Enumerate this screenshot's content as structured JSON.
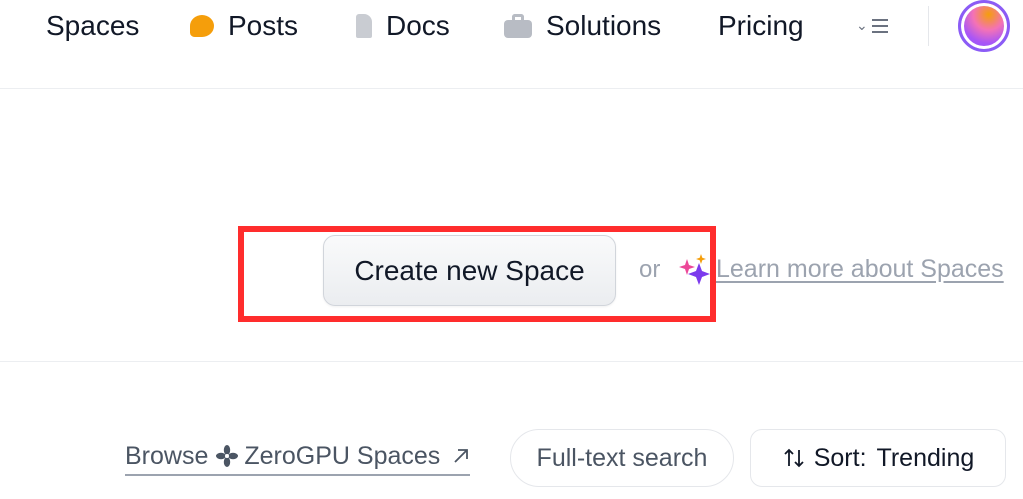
{
  "nav": {
    "items": [
      {
        "label": "Spaces",
        "icon": "spaces-grid-icon"
      },
      {
        "label": "Posts",
        "icon": "chat-bubble-icon"
      },
      {
        "label": "Docs",
        "icon": "document-icon"
      },
      {
        "label": "Solutions",
        "icon": "briefcase-icon"
      },
      {
        "label": "Pricing"
      }
    ],
    "more_icon": "chevron-menu-icon",
    "avatar_icon": "user-avatar"
  },
  "hero": {
    "create_button": "Create new Space",
    "or_text": "or",
    "learn_icon": "sparkle-icon",
    "learn_link": "Learn more about Spaces"
  },
  "toolbar": {
    "browse_prefix": "Browse",
    "browse_icon": "fan-icon",
    "browse_suffix": "ZeroGPU Spaces",
    "browse_arrow_icon": "external-arrow-icon",
    "search_button": "Full-text search",
    "sort_icon": "sort-arrows-icon",
    "sort_label": "Sort:",
    "sort_value": "Trending"
  },
  "colors": {
    "highlight": "#ff2d2d",
    "posts_accent": "#f59e0b",
    "avatar_ring": "#8b5cf6",
    "muted_text": "#9ca3af"
  }
}
